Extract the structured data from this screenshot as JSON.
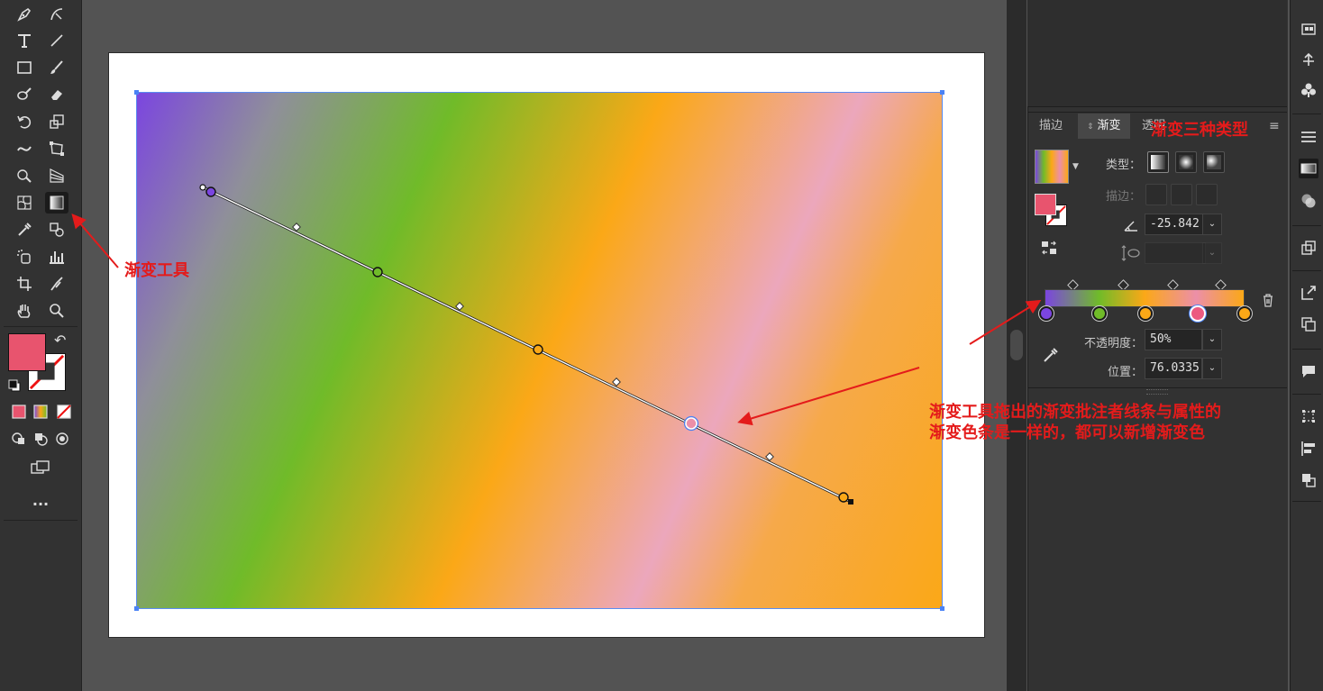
{
  "toolbar": {
    "tools_left": [
      "pen-icon",
      "type-icon",
      "rectangle-icon",
      "shaper-icon",
      "rotate-icon",
      "width-icon",
      "free-transform-icon",
      "mesh-icon",
      "eyedropper-icon",
      "symbol-sprayer-icon",
      "artboard-icon",
      "hand-icon"
    ],
    "tools_right": [
      "curvature-icon",
      "line-icon",
      "paintbrush-icon",
      "eraser-icon",
      "scale-icon",
      "warp-icon",
      "perspective-icon",
      "gradient-icon",
      "blend-icon",
      "column-graph-icon",
      "slice-icon",
      "zoom-icon"
    ],
    "active_tool": "gradient-icon",
    "fill_color": "#e8546e",
    "more_label": "..."
  },
  "panel": {
    "tabs": [
      "描边",
      "渐变",
      "透明"
    ],
    "active_tab": "渐变",
    "type_label": "类型：",
    "stroke_label": "描边：",
    "angle_value": "-25.842",
    "opacity_label": "不透明度：",
    "opacity_value": "50%",
    "location_label": "位置：",
    "location_value": "76.0335",
    "gradient_stops": [
      {
        "color": "#7b45e0",
        "location": 0
      },
      {
        "color": "#70bb29",
        "location": 27
      },
      {
        "color": "#fba817",
        "location": 50
      },
      {
        "color": "#ec5a80",
        "location": 76
      },
      {
        "color": "#fba817",
        "location": 100
      }
    ]
  },
  "annotations": {
    "gradient_tool": "渐变工具",
    "three_types": "渐变三种类型",
    "note_line1": "渐变工具拖出的渐变批注者线条与属性的",
    "note_line2": "渐变色条是一样的，都可以新增渐变色"
  },
  "colors": {
    "annotation_red": "#e41b1b",
    "selection_blue": "#5a8cf0"
  }
}
